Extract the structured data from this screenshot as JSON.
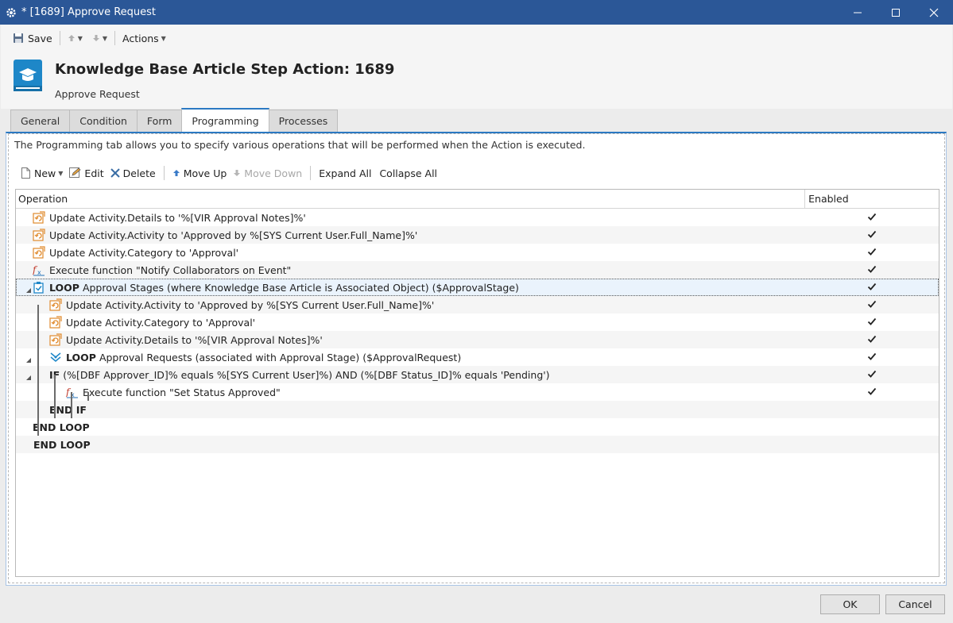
{
  "window": {
    "title": "* [1689] Approve Request",
    "controls": [
      "minimize",
      "maximize",
      "close"
    ]
  },
  "toolbar": {
    "save_label": "Save",
    "actions_label": "Actions"
  },
  "header": {
    "title": "Knowledge Base Article Step Action: 1689",
    "subtitle": "Approve Request"
  },
  "tabs": [
    {
      "label": "General",
      "active": false
    },
    {
      "label": "Condition",
      "active": false
    },
    {
      "label": "Form",
      "active": false
    },
    {
      "label": "Programming",
      "active": true
    },
    {
      "label": "Processes",
      "active": false
    }
  ],
  "programming": {
    "description": "The Programming tab allows you to specify various operations that will be performed when the Action is executed.",
    "toolbar": {
      "new_label": "New",
      "edit_label": "Edit",
      "delete_label": "Delete",
      "move_up_label": "Move Up",
      "move_down_label": "Move Down",
      "expand_all_label": "Expand All",
      "collapse_all_label": "Collapse All"
    },
    "columns": {
      "operation": "Operation",
      "enabled": "Enabled"
    },
    "rows": [
      {
        "keyword": "",
        "text": "Update Activity.Details to '%[VIR Approval Notes]%'",
        "icon": "update-icon",
        "enabled": true
      },
      {
        "keyword": "",
        "text": "Update Activity.Activity to 'Approved by %[SYS Current User.Full_Name]%'",
        "icon": "update-icon",
        "enabled": true
      },
      {
        "keyword": "",
        "text": "Update Activity.Category to 'Approval'",
        "icon": "update-icon",
        "enabled": true
      },
      {
        "keyword": "",
        "text": "Execute function \"Notify Collaborators on Event\"",
        "icon": "function-icon",
        "enabled": true
      },
      {
        "keyword": "LOOP",
        "text": "Approval Stages (where Knowledge Base Article is Associated Object) ($ApprovalStage)",
        "icon": "loop-icon",
        "enabled": true
      },
      {
        "keyword": "",
        "text": "Update Activity.Activity to 'Approved by %[SYS Current User.Full_Name]%'",
        "icon": "update-icon",
        "enabled": true
      },
      {
        "keyword": "",
        "text": "Update Activity.Category to 'Approval'",
        "icon": "update-icon",
        "enabled": true
      },
      {
        "keyword": "",
        "text": "Update Activity.Details to '%[VIR Approval Notes]%'",
        "icon": "update-icon",
        "enabled": true
      },
      {
        "keyword": "LOOP",
        "text": "Approval Requests (associated with Approval Stage) ($ApprovalRequest)",
        "icon": "loop-requests-icon",
        "enabled": true
      },
      {
        "keyword": "IF",
        "text": "(%[DBF Approver_ID]% equals %[SYS Current User]%) AND (%[DBF Status_ID]% equals 'Pending')",
        "icon": "",
        "enabled": true
      },
      {
        "keyword": "",
        "text": "Execute function \"Set Status Approved\"",
        "icon": "function-icon",
        "enabled": true
      },
      {
        "keyword": "END IF",
        "text": "",
        "icon": "",
        "enabled": false
      },
      {
        "keyword": "END LOOP",
        "text": "",
        "icon": "",
        "enabled": false
      },
      {
        "keyword": "END LOOP",
        "text": "",
        "icon": "",
        "enabled": false
      }
    ]
  },
  "footer": {
    "ok_label": "OK",
    "cancel_label": "Cancel"
  },
  "colors": {
    "titlebar": "#2b5797",
    "tab_accent": "#2b79c2",
    "icon_blue": "#1e87c8",
    "update_icon_orange": "#e08a2c"
  }
}
